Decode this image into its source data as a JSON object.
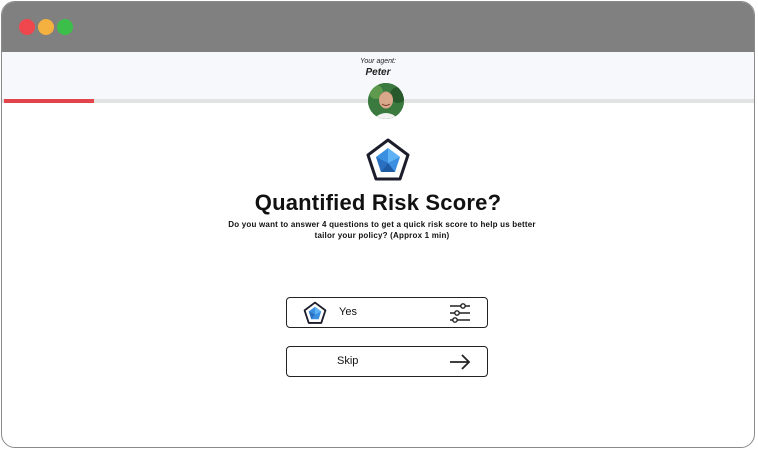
{
  "window": {
    "traffic_lights": [
      "close",
      "minimize",
      "maximize"
    ],
    "colors": {
      "close": "#f0474e",
      "minimize": "#f5b13f",
      "maximize": "#3cbf4a",
      "titlebar": "#808080"
    }
  },
  "agent": {
    "caption": "Your agent:",
    "name": "Peter"
  },
  "progress": {
    "fraction": 0.12,
    "color": "#e3434b"
  },
  "main": {
    "icon": "pentagon-radar-icon",
    "title": "Quantified Risk Score?",
    "subtitle": "Do you want to answer 4 questions to get a quick risk score to help us better tailor your policy? (Approx 1 min)"
  },
  "options": [
    {
      "label": "Yes",
      "icon_left": "pentagon-radar-icon",
      "icon_right": "sliders-icon"
    },
    {
      "label": "Skip",
      "icon_right": "arrow-right-icon"
    }
  ]
}
